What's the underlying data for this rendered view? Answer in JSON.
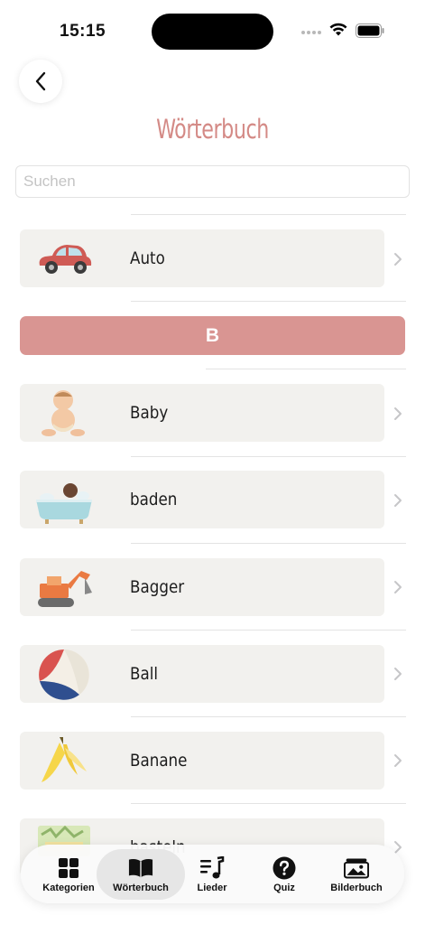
{
  "status_bar": {
    "time": "15:15"
  },
  "header": {
    "title": "Wörterbuch",
    "back_label": ""
  },
  "search": {
    "placeholder": "Suchen",
    "value": ""
  },
  "sections": [
    {
      "letter": "B"
    }
  ],
  "items": [
    {
      "label": "Auto",
      "icon": "toy-car-icon"
    },
    {
      "label": "Baby",
      "icon": "baby-icon"
    },
    {
      "label": "baden",
      "icon": "bathtub-icon"
    },
    {
      "label": "Bagger",
      "icon": "excavator-icon"
    },
    {
      "label": "Ball",
      "icon": "beach-ball-icon"
    },
    {
      "label": "Banane",
      "icon": "banana-icon"
    },
    {
      "label": "basteln",
      "icon": "crafts-icon"
    }
  ],
  "tabs": [
    {
      "label": "Kategorien",
      "icon": "grid-icon",
      "active": false
    },
    {
      "label": "Wörterbuch",
      "icon": "book-icon",
      "active": true
    },
    {
      "label": "Lieder",
      "icon": "music-note-icon",
      "active": false
    },
    {
      "label": "Quiz",
      "icon": "question-icon",
      "active": false
    },
    {
      "label": "Bilderbuch",
      "icon": "photo-album-icon",
      "active": false
    }
  ],
  "colors": {
    "title": "#d48a86",
    "section_header": "#d99592",
    "row_background": "#f2f1ee"
  }
}
